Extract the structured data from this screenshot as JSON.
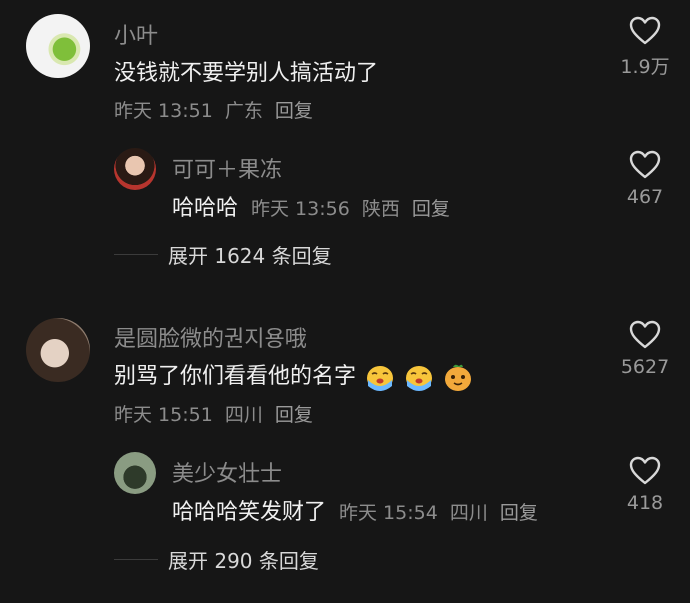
{
  "comments": [
    {
      "username": "小叶",
      "text": "没钱就不要学别人搞活动了",
      "time": "昨天 13:51",
      "location": "广东",
      "reply_label": "回复",
      "likes": "1.9万",
      "reply": {
        "username": "可可＋果冻",
        "text": "哈哈哈",
        "time": "昨天 13:56",
        "location": "陕西",
        "reply_label": "回复",
        "likes": "467"
      },
      "expand_label": "展开 1624 条回复"
    },
    {
      "username": "是圆脸微的권지용哦",
      "text": "别骂了你们看看他的名字",
      "time": "昨天 15:51",
      "location": "四川",
      "reply_label": "回复",
      "likes": "5627",
      "emojis": [
        "crying-face-emoji",
        "crying-face-emoji",
        "cheeky-face-emoji"
      ],
      "reply": {
        "username": "美少女壮士",
        "text": "哈哈哈笑发财了",
        "time": "昨天 15:54",
        "location": "四川",
        "reply_label": "回复",
        "likes": "418"
      },
      "expand_label": "展开 290 条回复"
    }
  ],
  "colors": {
    "background": "#161616",
    "text_primary": "#f0f0f0",
    "text_secondary": "#8c8c8c",
    "emoji_skin": "#f7c53b",
    "emoji_tear": "#6bb8ff"
  },
  "icons": {
    "like": "heart-outline-icon"
  }
}
